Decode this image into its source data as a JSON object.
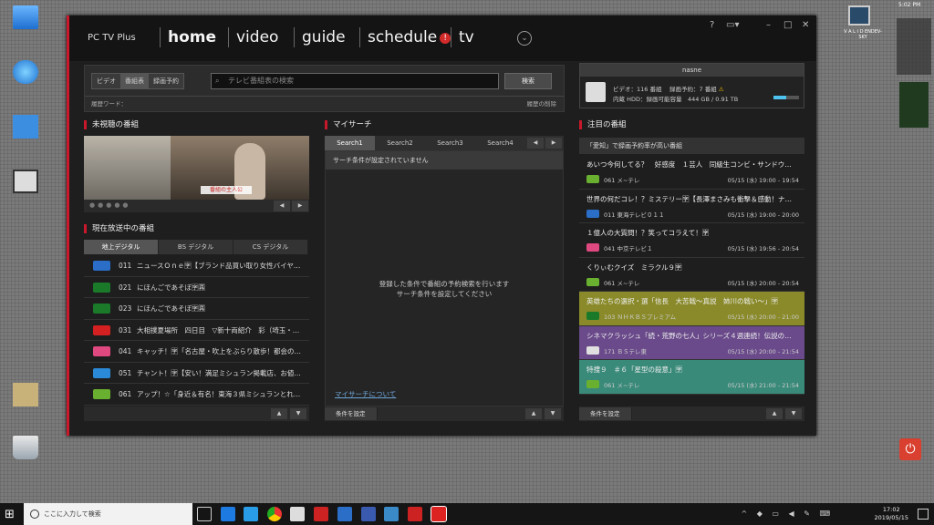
{
  "desktop": {
    "right_time_small": "5:02 PM",
    "right_widget_label": "V A L I D ENDEV-SKY",
    "power_label": "⏻"
  },
  "app": {
    "brand": "PC TV Plus",
    "nav": [
      {
        "label": "home"
      },
      {
        "label": "video"
      },
      {
        "label": "guide"
      },
      {
        "label": "schedule",
        "badge": "!"
      },
      {
        "label": "tv"
      }
    ],
    "window_controls": [
      "?",
      "–",
      "□",
      "✕"
    ]
  },
  "search": {
    "categories": [
      "ビデオ",
      "番組表",
      "録画予約"
    ],
    "placeholder": "テレビ番組表の検索",
    "button": "検索",
    "history_label": "履歴ワード：",
    "history_delete": "履歴の削除"
  },
  "nasne": {
    "title": "nasne",
    "line1": "ビデオ：116 番組　 録画予約：7 番組",
    "line2": "内蔵 HDD：録画可能容量　444 GB / 0.91 TB",
    "usage_fraction": 0.51
  },
  "unwatched": {
    "heading": "未視聴の番組",
    "caption": "番組の主人公"
  },
  "live": {
    "heading": "現在放送中の番組",
    "tabs": [
      "地上デジタル",
      "BS デジタル",
      "CS デジタル"
    ],
    "rows": [
      {
        "num": "011",
        "title": "ニュースＯｎｅ🈑【ブランド品買い取り女性バイヤ…",
        "color": "#2a6ec8"
      },
      {
        "num": "021",
        "title": "にほんごであそぼ🈑🈞",
        "color": "#1a7a2a"
      },
      {
        "num": "023",
        "title": "にほんごであそぼ🈑🈞",
        "color": "#1a7a2a"
      },
      {
        "num": "031",
        "title": "大相撲夏場所　四日目　▽新十両紹介　彩（埼玉・…",
        "color": "#d42020"
      },
      {
        "num": "041",
        "title": "キャッチ！🈑「名古屋・吹上をぶらり散歩！都会の…",
        "color": "#e04880"
      },
      {
        "num": "051",
        "title": "チャント！🈑【安い！満足ミシュラン掲載店、お値…",
        "color": "#2a8ad8"
      },
      {
        "num": "061",
        "title": "アップ！☆「身近＆有名！東海３県ミシュランとれ…",
        "color": "#6ab030"
      }
    ]
  },
  "mysearch": {
    "heading": "マイサーチ",
    "tabs": [
      "Search1",
      "Search2",
      "Search3",
      "Search4"
    ],
    "none": "サーチ条件が設定されていません",
    "msg1": "登録した条件で番組の予約検索を行います",
    "msg2": "サーチ条件を設定してください",
    "link": "マイサーチについて",
    "footer_button": "条件を設定"
  },
  "featured": {
    "heading": "注目の番組",
    "subheading": "「愛知」で録画予約率が高い番組",
    "footer_button": "条件を設定",
    "items": [
      {
        "title": "あいつ今何してる？　好感度　１芸人　同級生コンビ・サンドウ…",
        "ch": "061 メ~テレ",
        "dt": "05/15 (水) 19:00 - 19:54",
        "bg": "#1e1e1e",
        "logo": "#6ab030"
      },
      {
        "title": "世界の何だコレ！？ミステリー🈑【長澤まさみも衝撃＆感動！ナ…",
        "ch": "011 東海テレビ０１１",
        "dt": "05/15 (水) 19:00 - 20:00",
        "bg": "#1e1e1e",
        "logo": "#2a6ec8"
      },
      {
        "title": "１億人の大質問！？笑ってコラえて！🈑",
        "ch": "041 中京テレビ１",
        "dt": "05/15 (水) 19:56 - 20:54",
        "bg": "#1e1e1e",
        "logo": "#e04880"
      },
      {
        "title": "くりぃむクイズ　ミラクル９🈑",
        "ch": "061 メ~テレ",
        "dt": "05/15 (水) 20:00 - 20:54",
        "bg": "#1e1e1e",
        "logo": "#6ab030"
      },
      {
        "title": "英雄たちの選択・選「信長　大苦戦～真説　姉川の戦い～」🈑",
        "ch": "103 ＮＨＫＢＳプレミアム",
        "dt": "05/15 (水) 20:00 - 21:00",
        "bg": "#8a8a2a",
        "logo": "#1a7a2a"
      },
      {
        "title": "シネマクラッシュ「続・荒野の七人」シリーズ４週連続！伝説の…",
        "ch": "171 ＢＳテレ東",
        "dt": "05/15 (水) 20:00 - 21:54",
        "bg": "#6a4a8a",
        "logo": "#e0e0e0"
      },
      {
        "title": "特捜９　＃６「星型の殺意」🈑",
        "ch": "061 メ~テレ",
        "dt": "05/15 (水) 21:00 - 21:54",
        "bg": "#3a8a7a",
        "logo": "#6ab030"
      }
    ]
  },
  "taskbar": {
    "search_placeholder": "ここに入力して検索",
    "time": "17:02",
    "date": "2019/05/15"
  }
}
